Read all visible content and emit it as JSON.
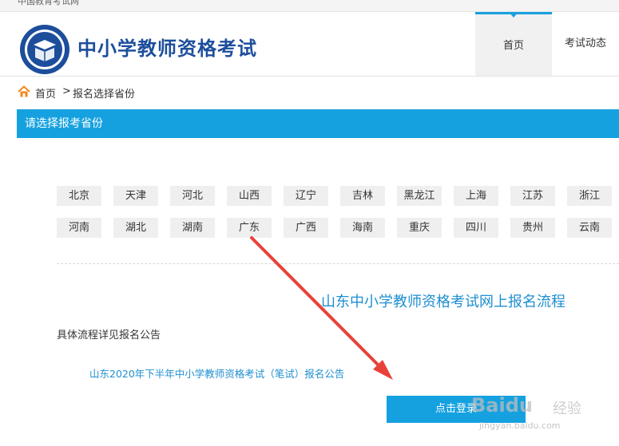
{
  "topbar": {
    "text": "中国教育考试网"
  },
  "header": {
    "site_title": "中小学教师资格考试",
    "nav": [
      {
        "label": "首页",
        "active": true
      },
      {
        "label": "考试动态",
        "active": false
      }
    ]
  },
  "breadcrumb": {
    "home": "首页",
    "separator": ">",
    "current": "报名选择省份"
  },
  "section": {
    "title": "请选择报考省份"
  },
  "provinces": [
    [
      "北京",
      "天津",
      "河北",
      "山西",
      "辽宁",
      "吉林",
      "黑龙江",
      "上海",
      "江苏",
      "浙江"
    ],
    [
      "河南",
      "湖北",
      "湖南",
      "广东",
      "广西",
      "海南",
      "重庆",
      "四川",
      "贵州",
      "云南"
    ]
  ],
  "content": {
    "process_title": "山东中小学教师资格考试网上报名流程",
    "detail_note": "具体流程详见报名公告",
    "notice_link": "山东2020年下半年中小学教师资格考试（笔试）报名公告",
    "login_button": "点击登录"
  },
  "watermark": {
    "brand": "Baidu",
    "brand_cn": "经验",
    "url": "jingyan.baidu.com"
  },
  "colors": {
    "accent": "#15a1e0",
    "title_blue": "#1d4e9c",
    "link_blue": "#1f8fd0",
    "arrow_red": "#e8413a"
  },
  "icons": {
    "home": "home-icon",
    "logo": "logo-seal-icon",
    "annotation": "red-arrow-icon"
  }
}
